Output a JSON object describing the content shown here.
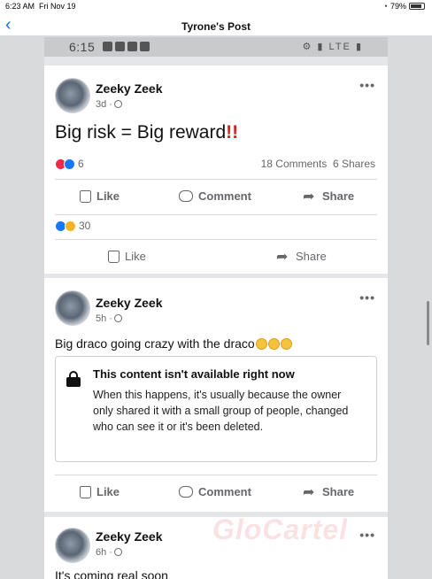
{
  "status_bar": {
    "time": "6:23 AM",
    "date": "Fri Nov 19",
    "battery": "79%"
  },
  "nav": {
    "back_icon": "chevron-left-icon",
    "title": "Tyrone's Post"
  },
  "phone_status": {
    "time": "6:15",
    "network": "LTE"
  },
  "post1": {
    "author": "Zeeky Zeek",
    "age": "3d ·",
    "text": "Big risk = Big reward",
    "text_emphasis": "!!",
    "reaction_count": "6",
    "comments": "18 Comments",
    "shares": "6 Shares",
    "actions": {
      "like": "Like",
      "comment": "Comment",
      "share": "Share"
    }
  },
  "comment_block": {
    "reaction_count": "30",
    "actions": {
      "like": "Like",
      "share": "Share"
    }
  },
  "post2": {
    "author": "Zeeky Zeek",
    "age": "5h ·",
    "text": "Big draco going crazy with the draco",
    "unavailable_title": "This content isn't available right now",
    "unavailable_body": "When this happens, it's usually because the owner only shared it with a small group of people, changed who can see it or it's been deleted.",
    "actions": {
      "like": "Like",
      "comment": "Comment",
      "share": "Share"
    }
  },
  "post3": {
    "author": "Zeeky Zeek",
    "age": "6h ·",
    "text": "It's coming real soon"
  },
  "watermark": "GloCartel",
  "colors": {
    "accent": "#1877f2",
    "love": "#f02849",
    "wow": "#f7b125",
    "alert": "#e02020"
  }
}
